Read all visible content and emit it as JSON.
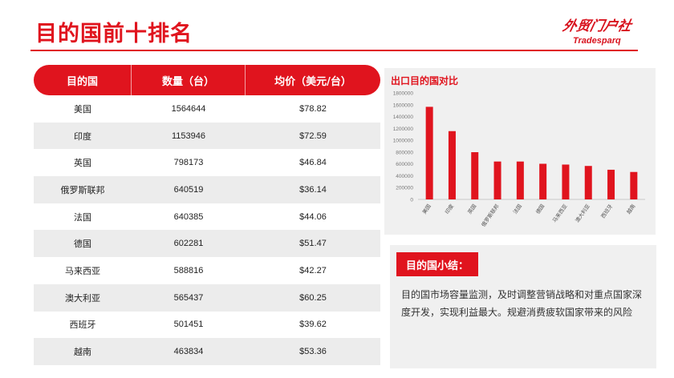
{
  "page": {
    "title": "目的国前十排名"
  },
  "logo": {
    "script": "外贸门户社",
    "text": "Tradesparq"
  },
  "table": {
    "headers": [
      "目的国",
      "数量（台）",
      "均价（美元/台）"
    ],
    "rows": [
      [
        "美国",
        "1564644",
        "$78.82"
      ],
      [
        "印度",
        "1153946",
        "$72.59"
      ],
      [
        "英国",
        "798173",
        "$46.84"
      ],
      [
        "俄罗斯联邦",
        "640519",
        "$36.14"
      ],
      [
        "法国",
        "640385",
        "$44.06"
      ],
      [
        "德国",
        "602281",
        "$51.47"
      ],
      [
        "马来西亚",
        "588816",
        "$42.27"
      ],
      [
        "澳大利亚",
        "565437",
        "$60.25"
      ],
      [
        "西班牙",
        "501451",
        "$39.62"
      ],
      [
        "越南",
        "463834",
        "$53.36"
      ]
    ]
  },
  "chart_data": {
    "type": "bar",
    "title": "出口目的国对比",
    "categories": [
      "美国",
      "印度",
      "英国",
      "俄罗斯联邦",
      "法国",
      "德国",
      "马来西亚",
      "澳大利亚",
      "西班牙",
      "越南"
    ],
    "values": [
      1564644,
      1153946,
      798173,
      640519,
      640385,
      602281,
      588816,
      565437,
      501451,
      463834
    ],
    "yticks": [
      "0",
      "200000",
      "400000",
      "600000",
      "800000",
      "1000000",
      "1200000",
      "1400000",
      "1600000",
      "1800000"
    ],
    "ylim": [
      0,
      1800000
    ],
    "bar_color": "#e0141e",
    "grid": false
  },
  "summary": {
    "label": "目的国小结：",
    "text": "目的国市场容量监测，及时调整营销战略和对重点国家深度开发，实现利益最大。规避消费疲软国家带来的风险"
  }
}
